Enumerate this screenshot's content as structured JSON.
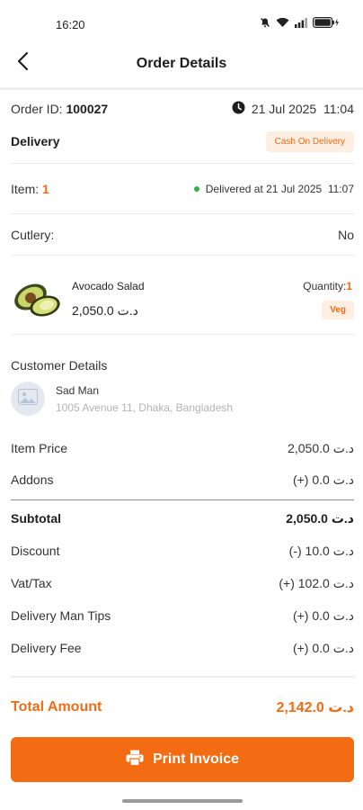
{
  "status_bar": {
    "time": "16:20"
  },
  "app_bar": {
    "title": "Order Details"
  },
  "order": {
    "id_label": "Order ID:",
    "id_value": "100027",
    "datetime": "21 Jul 2025  11:04",
    "type": "Delivery",
    "payment_badge": "Cash On Delivery",
    "item_label": "Item:",
    "item_count": "1",
    "delivered_text": "Delivered at 21 Jul 2025  11:07",
    "cutlery_label": "Cutlery:",
    "cutlery_value": "No"
  },
  "food": {
    "name": "Avocado Salad",
    "price": "2,050.0 د.ت",
    "quantity_label": "Quantity:",
    "quantity_value": "1",
    "tag": "Veg"
  },
  "customer": {
    "section_title": "Customer Details",
    "name": "Sad Man",
    "address": "1005 Avenue 11, Dhaka, Bangladesh"
  },
  "summary": {
    "item_price_label": "Item Price",
    "item_price_value": "2,050.0 د.ت",
    "addons_label": "Addons",
    "addons_value": "(+) 0.0 د.ت",
    "subtotal_label": "Subtotal",
    "subtotal_value": "2,050.0 د.ت",
    "discount_label": "Discount",
    "discount_value": "(-) 10.0 د.ت",
    "vat_label": "Vat/Tax",
    "vat_value": "(+) 102.0 د.ت",
    "tips_label": "Delivery Man Tips",
    "tips_value": "(+) 0.0 د.ت",
    "fee_label": "Delivery Fee",
    "fee_value": "(+) 0.0 د.ت",
    "total_label": "Total Amount",
    "total_value": "2,142.0 د.ت"
  },
  "actions": {
    "print_label": "Print Invoice"
  },
  "colors": {
    "accent": "#f36b12",
    "badge_bg": "#fdeee2",
    "delivered_dot": "#2fb344"
  },
  "icons": [
    "back-arrow-icon",
    "clock-icon",
    "printer-icon",
    "image-placeholder-icon",
    "wifi-icon",
    "signal-icon",
    "battery-icon",
    "mute-icon"
  ]
}
